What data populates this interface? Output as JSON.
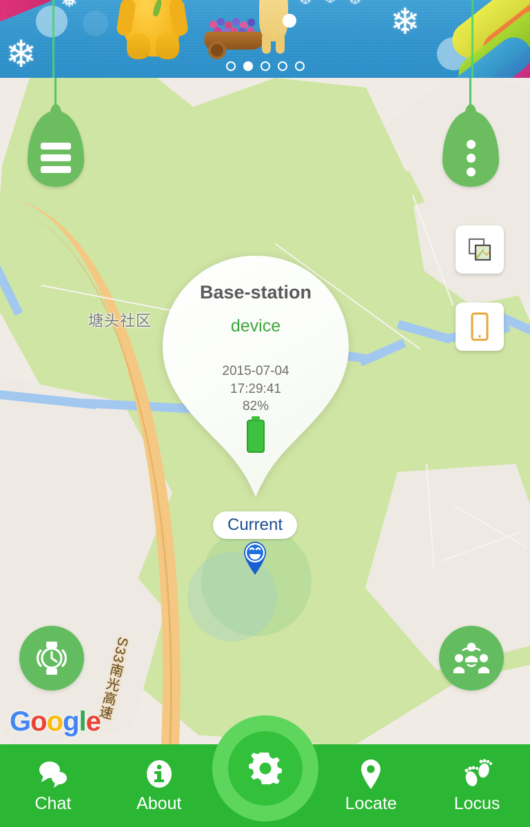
{
  "banner": {
    "name": "promo-carousel",
    "dots": [
      false,
      true,
      false,
      false,
      false
    ],
    "dot_count": 5,
    "active_dot_index": 1
  },
  "map": {
    "labels": [
      {
        "text": "塘头社区",
        "kind": "neighborhood"
      },
      {
        "text": "S33南光高速",
        "kind": "highway"
      }
    ],
    "attribution": {
      "letters": [
        "G",
        "o",
        "o",
        "g",
        "l",
        "e"
      ],
      "name": "Google"
    },
    "colors": {
      "park": "#cfe5a4",
      "land": "#eeeae3",
      "river": "#a3c8f0",
      "highway": "#f4c882",
      "accent_green": "#2bb634"
    }
  },
  "controls": {
    "menu_button": {
      "icon": "hamburger-menu-icon",
      "label": "Menu"
    },
    "overflow_button": {
      "icon": "more-vertical-icon",
      "label": "More"
    },
    "layers_button": {
      "icon": "map-layers-icon",
      "label": "Map type"
    },
    "device_button": {
      "icon": "phone-device-icon",
      "label": "Device"
    },
    "watch_button": {
      "icon": "smartwatch-icon",
      "label": "Watch"
    },
    "family_button": {
      "icon": "family-group-icon",
      "label": "Family"
    }
  },
  "info_balloon": {
    "title": "Base-station",
    "subtitle": "device",
    "date": "2015-07-04",
    "time": "17:29:41",
    "battery_percent": "82%",
    "battery_icon": "battery-full-icon",
    "title_color": "#5a5a5a",
    "subtitle_color": "#3fa63f"
  },
  "current_marker": {
    "label": "Current",
    "icon": "smiley-pin-icon",
    "label_color": "#1c4c8c",
    "pin_color": "#1a5fd0"
  },
  "bottom_nav": {
    "items": [
      {
        "label": "Chat",
        "icon": "chat-bubbles-icon"
      },
      {
        "label": "About",
        "icon": "info-circle-icon"
      },
      {
        "label": "",
        "icon": "gear-icon"
      },
      {
        "label": "Locate",
        "icon": "map-pin-icon"
      },
      {
        "label": "Locus",
        "icon": "footprints-icon"
      }
    ],
    "fab": {
      "icon": "gear-icon",
      "label": "Settings"
    },
    "bar_color": "#2bb634",
    "fab_color": "#33c13c"
  }
}
